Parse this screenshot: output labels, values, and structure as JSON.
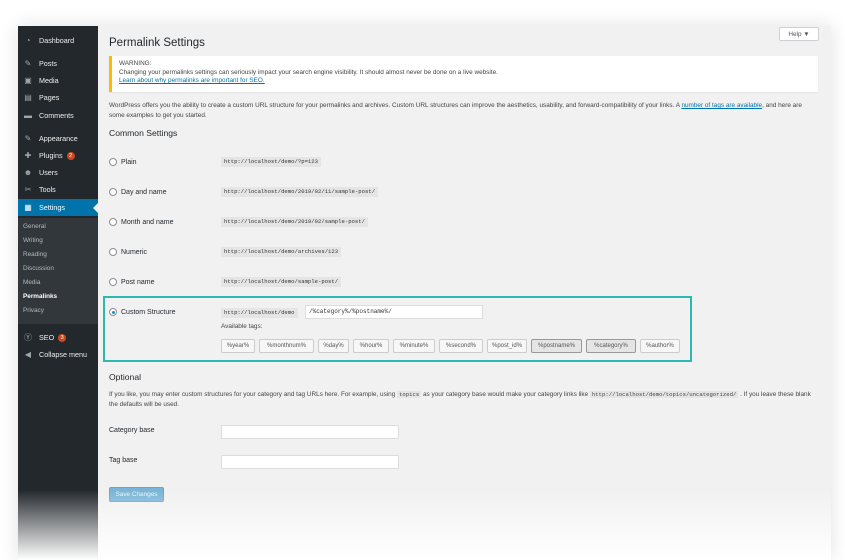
{
  "sidebar": {
    "items": [
      {
        "label": "Dashboard",
        "icon": "dashboard-icon",
        "glyph": "◔"
      },
      {
        "label": "Posts",
        "icon": "pin-icon",
        "glyph": "✎"
      },
      {
        "label": "Media",
        "icon": "media-icon",
        "glyph": "▣"
      },
      {
        "label": "Pages",
        "icon": "pages-icon",
        "glyph": "▤"
      },
      {
        "label": "Comments",
        "icon": "comments-icon",
        "glyph": "▬"
      },
      {
        "label": "Appearance",
        "icon": "brush-icon",
        "glyph": "✎"
      },
      {
        "label": "Plugins",
        "icon": "plugin-icon",
        "glyph": "✚",
        "badge": "2"
      },
      {
        "label": "Users",
        "icon": "users-icon",
        "glyph": "☻"
      },
      {
        "label": "Tools",
        "icon": "wrench-icon",
        "glyph": "✂"
      },
      {
        "label": "Settings",
        "icon": "settings-icon",
        "glyph": "▦"
      }
    ],
    "submenu": [
      "General",
      "Writing",
      "Reading",
      "Discussion",
      "Media",
      "Permalinks",
      "Privacy"
    ],
    "seo": {
      "label": "SEO",
      "icon": "yoast-icon",
      "glyph": "Ⓨ",
      "badge": "3"
    },
    "collapse": {
      "label": "Collapse menu",
      "icon": "collapse-icon",
      "glyph": "◀"
    }
  },
  "help_label": "Help ▼",
  "page_title": "Permalink Settings",
  "notice": {
    "title": "WARNING:",
    "text": "Changing your permalinks settings can seriously impact your search engine visibility. It should almost never be done on a live website.",
    "link": "Learn about why permalinks are important for SEO."
  },
  "intro": {
    "text": "WordPress offers you the ability to create a custom URL structure for your permalinks and archives. Custom URL structures can improve the aesthetics, usability, and forward-compatibility of your links. A ",
    "link": "number of tags are available",
    "tail": ", and here are some examples to get you started."
  },
  "common_heading": "Common Settings",
  "options": [
    {
      "label": "Plain",
      "example": "http://localhost/demo/?p=123",
      "checked": false
    },
    {
      "label": "Day and name",
      "example": "http://localhost/demo/2019/02/11/sample-post/",
      "checked": false
    },
    {
      "label": "Month and name",
      "example": "http://localhost/demo/2019/02/sample-post/",
      "checked": false
    },
    {
      "label": "Numeric",
      "example": "http://localhost/demo/archives/123",
      "checked": false
    },
    {
      "label": "Post name",
      "example": "http://localhost/demo/sample-post/",
      "checked": false
    }
  ],
  "custom": {
    "label": "Custom Structure",
    "prefix": "http://localhost/demo",
    "value": "/%category%/%postname%/",
    "checked": true,
    "available_label": "Available tags:",
    "tags": [
      "%year%",
      "%monthnum%",
      "%day%",
      "%hour%",
      "%minute%",
      "%second%",
      "%post_id%",
      "%postname%",
      "%category%",
      "%author%"
    ],
    "active_tags": [
      "%postname%",
      "%category%"
    ]
  },
  "optional": {
    "heading": "Optional",
    "desc_1": "If you like, you may enter custom structures for your category and tag URLs here. For example, using ",
    "code_1": "topics",
    "desc_2": " as your category base would make your category links like ",
    "code_2": "http://localhost/demo/topics/uncategorized/",
    "desc_3": " . If you leave these blank the defaults will be used.",
    "category_label": "Category base",
    "tag_label": "Tag base"
  },
  "save_label": "Save Changes",
  "colors": {
    "sidebar": "#23282d",
    "accent": "#0073aa",
    "highlight": "#2eb8ae",
    "warning": "#ffb900"
  }
}
